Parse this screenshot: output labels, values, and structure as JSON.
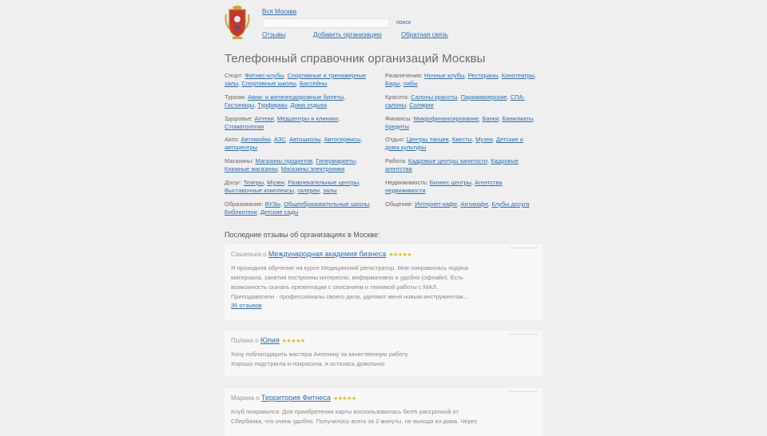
{
  "header": {
    "city_link": "Вся Москва",
    "search_placeholder": "",
    "search_button": "поиск",
    "nav": [
      {
        "label": "Отзывы"
      },
      {
        "label": "Добавить организацию"
      },
      {
        "label": "Обратная связь"
      }
    ]
  },
  "page_title": "Телефонный справочник организаций Москвы",
  "categories": [
    {
      "label": "Спорт:",
      "links": [
        "Фитнес-клубы",
        "Спортивные и тренажерные залы",
        "Спортивные школы",
        "Бассейны"
      ]
    },
    {
      "label": "Развлечения:",
      "links": [
        "Ночные клубы",
        "Рестораны",
        "Кинотеатры",
        "Бары",
        "пабы"
      ]
    },
    {
      "label": "Туризм:",
      "links": [
        "Авиа- и железнодорожные билеты",
        "Гостиницы",
        "Турфирмы",
        "Дома отдыха"
      ]
    },
    {
      "label": "Красота:",
      "links": [
        "Салоны красоты",
        "Парикмахерские",
        "СПА-салоны",
        "Солярии"
      ]
    },
    {
      "label": "Здоровье:",
      "links": [
        "Аптеки",
        "Медцентры и клиники",
        "Стоматологии"
      ]
    },
    {
      "label": "Финансы:",
      "links": [
        "Микрофинансирование",
        "Банки",
        "Банкоматы",
        "Кредиты"
      ]
    },
    {
      "label": "Авто:",
      "links": [
        "Автомойки",
        "АЗС",
        "Автошколы",
        "Автосервисы",
        "автоцентры"
      ]
    },
    {
      "label": "Отдых:",
      "links": [
        "Центры танцев",
        "Квесты",
        "Музеи",
        "Детские и дома культуры"
      ]
    },
    {
      "label": "Магазины:",
      "links": [
        "Магазины продуктов",
        "Гипермаркеты",
        "Книжные магазины",
        "Магазины электроники"
      ]
    },
    {
      "label": "Работа:",
      "links": [
        "Кадровые центры занятости",
        "Кадровые агентства"
      ]
    },
    {
      "label": "Досуг:",
      "links": [
        "Театры",
        "Музеи",
        "Развлекательные центры",
        "Выставочные комплексы",
        "галереи",
        "залы"
      ]
    },
    {
      "label": "Недвижимость:",
      "links": [
        "Бизнес центры",
        "Агентства недвижимости"
      ]
    },
    {
      "label": "Образование:",
      "links": [
        "ВУЗы",
        "Общеобразовательные школы",
        "Библиотеки",
        "Детские сады"
      ]
    },
    {
      "label": "Общение:",
      "links": [
        "Интернет-кафе",
        "Антикафе",
        "Клубы досуга"
      ]
    }
  ],
  "reviews_heading": "Последние отзывы об организациях в Москве:",
  "reviews": [
    {
      "author": "Сашенька",
      "prep": "о",
      "org": "Международная академия бизнеса",
      "stars": "★★★★★",
      "lines": [
        "Я проходила обучение на курсе Медицинский регистратор. Мне понравилась подача",
        "материала, занятия построены интересно, информативно и удобно (офлайн). Есть",
        "возможность скачать презентации с описанием и техникой работы с МАЛ.",
        "Преподаватели - профессионалы своего дела, уделяют меня новым инструментом..."
      ],
      "more": "35 отзывов"
    },
    {
      "author": "Полина",
      "prep": "о",
      "org": "Юлия",
      "stars": "★★★★★",
      "lines": [
        "Хочу поблагодарить мастера Ангелину за качественную работу",
        "Хорошо подстригла и покрасила, я осталась довольна!"
      ],
      "more": ""
    },
    {
      "author": "Марина",
      "prep": "о",
      "org": "Территория Фитнеса",
      "stars": "★★★★★",
      "lines": [
        "Клуб понравился. Для приобретения карты воспользовалась без% рассрочкой от",
        "Сбербанка, что очень удобно. Получилось всего за 2 минуты, не выходя из дома. Через"
      ],
      "more": ""
    }
  ],
  "colors": {
    "link": "#2a6fb6",
    "star": "#e7b915",
    "background": "#efefef"
  }
}
